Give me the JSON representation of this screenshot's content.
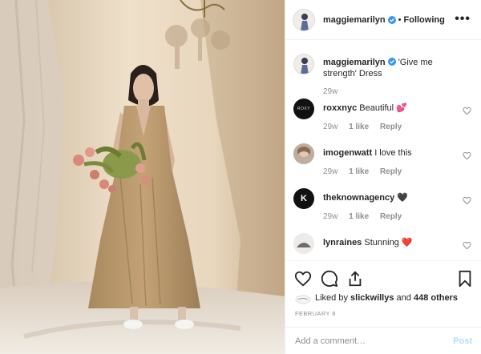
{
  "header": {
    "username": "maggiemarilyn",
    "separator": "•",
    "follow_label": "Following",
    "more_label": "•••"
  },
  "caption": {
    "username": "maggiemarilyn",
    "text": "'Give me strength' Dress",
    "time": "29w"
  },
  "comments": [
    {
      "username": "roxxnyc",
      "text": "Beautiful",
      "emoji": "💕",
      "time": "29w",
      "likes": "1 like",
      "reply": "Reply",
      "avatar_text": "ROXY"
    },
    {
      "username": "imogenwatt",
      "text": "I love this",
      "emoji": "",
      "time": "29w",
      "likes": "1 like",
      "reply": "Reply"
    },
    {
      "username": "theknownagency",
      "text": "",
      "emoji": "🖤",
      "time": "29w",
      "likes": "1 like",
      "reply": "Reply",
      "avatar_text": "K"
    },
    {
      "username": "lynraines",
      "text": "Stunning",
      "emoji": "❤️",
      "time": "",
      "likes": "",
      "reply": ""
    }
  ],
  "likes": {
    "prefix": "Liked by",
    "user": "slickwillys",
    "conj": "and",
    "others": "448 others"
  },
  "date": "FEBRUARY 8",
  "add_comment": {
    "placeholder": "Add a comment…",
    "post_label": "Post"
  },
  "colors": {
    "verified": "#3897f0",
    "post_disabled": "#b3dbff",
    "meta": "#8e8e8e"
  }
}
